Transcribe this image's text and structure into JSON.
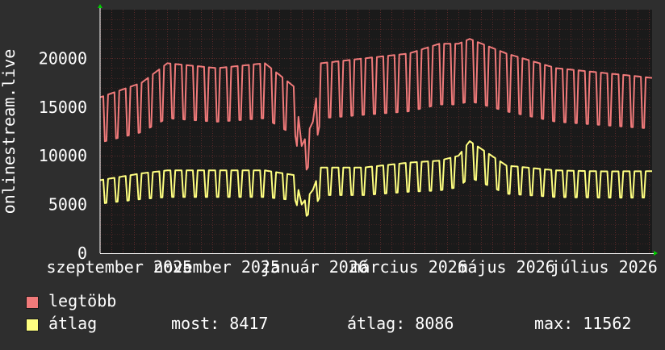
{
  "chart_data": {
    "type": "line",
    "ylabel": "onlinestream.live",
    "ylim": [
      0,
      25000
    ],
    "yticks": [
      0,
      5000,
      10000,
      15000,
      20000
    ],
    "ytick_labels": [
      "0",
      "5000",
      "10000",
      "15000",
      "20000"
    ],
    "xlim": [
      "2025-08-20",
      "2026-07-31"
    ],
    "xtick_labels": [
      "szeptember 2025",
      "november 2025",
      "január 2026",
      "március 2026",
      "május 2026",
      "július 2026"
    ],
    "xtick_dates": [
      "2025-09-01",
      "2025-11-01",
      "2026-01-01",
      "2026-03-01",
      "2026-05-01",
      "2026-07-01"
    ],
    "grid": true,
    "legend_placement": "bottom-left",
    "colors": {
      "background": "#2e2e2e",
      "plot_background": "#1a1a1a",
      "grid": "#5a2a2a",
      "axis": "#ffffff",
      "arrow": "#00cc00",
      "text": "#ffffff"
    },
    "series": [
      {
        "name": "legtöbb",
        "color": "#f07a7a",
        "weekday_level": 19000,
        "weekend_level": 13500,
        "points": [
          [
            "2025-08-20",
            16000
          ],
          [
            "2025-09-15",
            17500
          ],
          [
            "2025-10-01",
            19500
          ],
          [
            "2025-11-01",
            19000
          ],
          [
            "2025-12-01",
            19500
          ],
          [
            "2025-12-20",
            17000
          ],
          [
            "2025-12-24",
            11000
          ],
          [
            "2025-12-31",
            13500
          ],
          [
            "2026-01-05",
            19500
          ],
          [
            "2026-02-01",
            20000
          ],
          [
            "2026-03-01",
            20500
          ],
          [
            "2026-03-20",
            21500
          ],
          [
            "2026-04-01",
            21500
          ],
          [
            "2026-04-08",
            22000
          ],
          [
            "2026-05-01",
            20500
          ],
          [
            "2026-06-01",
            19000
          ],
          [
            "2026-07-01",
            18500
          ],
          [
            "2026-07-31",
            18000
          ]
        ]
      },
      {
        "name": "átlag",
        "color": "#ffff80",
        "weekday_level": 8400,
        "weekend_level": 5700,
        "points": [
          [
            "2025-08-20",
            7500
          ],
          [
            "2025-09-15",
            8200
          ],
          [
            "2025-10-01",
            8500
          ],
          [
            "2025-11-01",
            8500
          ],
          [
            "2025-12-01",
            8500
          ],
          [
            "2025-12-20",
            8000
          ],
          [
            "2025-12-24",
            5000
          ],
          [
            "2025-12-31",
            6500
          ],
          [
            "2026-01-05",
            8800
          ],
          [
            "2026-02-01",
            8800
          ],
          [
            "2026-03-01",
            9300
          ],
          [
            "2026-03-20",
            9500
          ],
          [
            "2026-04-01",
            10000
          ],
          [
            "2026-04-08",
            11500
          ],
          [
            "2026-05-01",
            9000
          ],
          [
            "2026-06-01",
            8500
          ],
          [
            "2026-07-01",
            8400
          ],
          [
            "2026-07-31",
            8417
          ]
        ]
      }
    ]
  },
  "legend": {
    "items": [
      {
        "label": "legtöbb",
        "color": "#f07a7a"
      },
      {
        "label": "átlag",
        "color": "#ffff80"
      }
    ],
    "stats": {
      "most": "most: 8417",
      "atlag": "átlag: 8086",
      "max": "max: 11562"
    }
  }
}
